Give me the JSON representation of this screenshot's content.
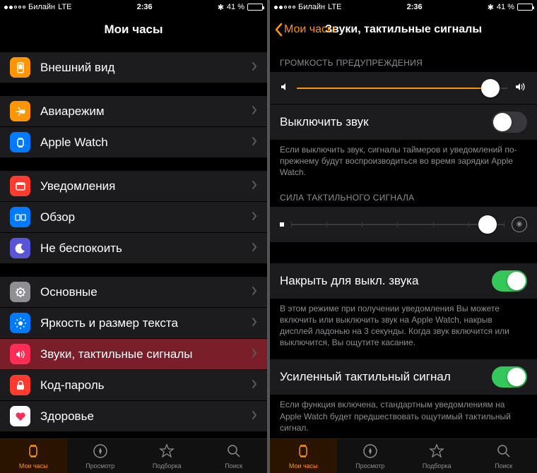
{
  "status": {
    "carrier": "Билайн",
    "network": "LTE",
    "time": "2:36",
    "battery_pct": "41 %",
    "bluetooth": "✱"
  },
  "left": {
    "title": "Мои часы",
    "groups": [
      [
        {
          "icon": "appearance-icon",
          "label": "Внешний вид",
          "color": "#ff9500"
        }
      ],
      [
        {
          "icon": "airplane-icon",
          "label": "Авиарежим",
          "color": "#ff9500"
        },
        {
          "icon": "apple-watch-icon",
          "label": "Apple Watch",
          "color": "#007aff"
        }
      ],
      [
        {
          "icon": "notifications-icon",
          "label": "Уведомления",
          "color": "#ff3b30"
        },
        {
          "icon": "glances-icon",
          "label": "Обзор",
          "color": "#007aff"
        },
        {
          "icon": "dnd-icon",
          "label": "Не беспокоить",
          "color": "#5856d6"
        }
      ],
      [
        {
          "icon": "general-icon",
          "label": "Основные",
          "color": "#8e8e93"
        },
        {
          "icon": "brightness-icon",
          "label": "Яркость и размер текста",
          "color": "#007aff"
        },
        {
          "icon": "sounds-icon",
          "label": "Звуки, тактильные сигналы",
          "color": "#ff2d55",
          "selected": true
        },
        {
          "icon": "passcode-icon",
          "label": "Код-пароль",
          "color": "#ff3b30"
        },
        {
          "icon": "health-icon",
          "label": "Здоровье",
          "color": "#ffffff"
        }
      ]
    ]
  },
  "right": {
    "back_label": "Мои часы",
    "title": "Звуки, тактильные сигналы",
    "volume": {
      "header": "ГРОМКОСТЬ ПРЕДУПРЕЖДЕНИЯ",
      "value_pct": 92
    },
    "mute": {
      "label": "Выключить звук",
      "on": false,
      "footer": "Если выключить звук, сигналы таймеров и уведомлений по-прежнему будут воспроизводиться во время зарядки Apple Watch."
    },
    "haptic": {
      "header": "СИЛА ТАКТИЛЬНОГО СИГНАЛА",
      "value_pct": 92
    },
    "cover": {
      "label": "Накрыть для выкл. звука",
      "on": true,
      "footer": "В этом режиме при получении уведомления Вы можете включить или выключить звук на Apple Watch, накрыв дисплей ладонью на 3 секунды. Когда звук включится или выключится, Вы ощутите касание."
    },
    "prominent": {
      "label": "Усиленный тактильный сигнал",
      "on": true,
      "footer": "Если функция включена, стандартным уведомлениям на Apple Watch будет предшествовать ощутимый тактильный сигнал."
    }
  },
  "tabs": {
    "items": [
      {
        "label": "Мои часы",
        "icon": "watch-tab-icon",
        "active": true
      },
      {
        "label": "Просмотр",
        "icon": "browse-tab-icon"
      },
      {
        "label": "Подборка",
        "icon": "featured-tab-icon"
      },
      {
        "label": "Поиск",
        "icon": "search-tab-icon"
      }
    ]
  }
}
